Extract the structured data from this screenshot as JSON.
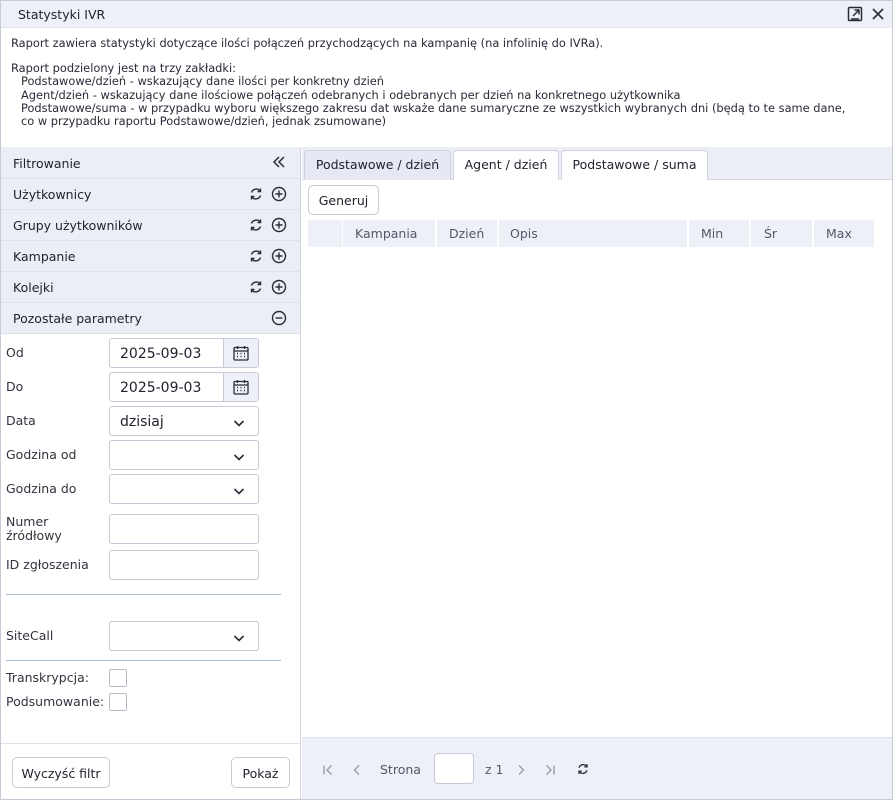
{
  "window": {
    "title": "Statystyki IVR"
  },
  "description": {
    "intro": "Raport zawiera statystyki dotyczące ilości połączeń przychodzących na kampanię (na infolinię do IVRa).",
    "tabs_intro": "Raport podzielony jest na trzy zakładki:",
    "line1": "Podstawowe/dzień - wskazujący dane ilości per konkretny dzień",
    "line2": "Agent/dzień - wskazujący dane ilościowe połączeń odebranych i odebranych per dzień na konkretnego użytkownika",
    "line3": "Podstawowe/suma - w przypadku wyboru większego zakresu dat wskaże dane sumaryczne ze wszystkich wybranych dni (będą to te same dane,",
    "line4": "co w przypadku raportu Podstawowe/dzień, jednak zsumowane)"
  },
  "filters": {
    "header": "Filtrowanie",
    "sections": {
      "users": "Użytkownicy",
      "user_groups": "Grupy użytkowników",
      "campaigns": "Kampanie",
      "queues": "Kolejki",
      "other_params": "Pozostałe parametry"
    },
    "fields": {
      "od_label": "Od",
      "od_value": "2025-09-03",
      "do_label": "Do",
      "do_value": "2025-09-03",
      "data_label": "Data",
      "data_value": "dzisiaj",
      "godzina_od_label": "Godzina od",
      "godzina_od_value": "",
      "godzina_do_label": "Godzina do",
      "godzina_do_value": "",
      "numer_label_1": "Numer",
      "numer_label_2": "źródłowy",
      "numer_value": "",
      "id_label": "ID zgłoszenia",
      "id_value": "",
      "sitecall_label": "SiteCall",
      "sitecall_value": "",
      "transkrypcja_label": "Transkrypcja:",
      "transkrypcja_checked": false,
      "podsumowanie_label": "Podsumowanie:",
      "podsumowanie_checked": false
    },
    "buttons": {
      "clear": "Wyczyść filtr",
      "show": "Pokaż"
    }
  },
  "report": {
    "tabs": [
      "Podstawowe / dzień",
      "Agent / dzień",
      "Podstawowe / suma"
    ],
    "active_tab": 0,
    "generate_label": "Generuj",
    "columns": [
      "Kampania",
      "Dzień",
      "Opis",
      "Min",
      "Śr",
      "Max"
    ],
    "rows": []
  },
  "pager": {
    "page_label": "Strona",
    "page_value": "",
    "of_label": "z 1"
  },
  "colors": {
    "panel_header": "#eceef6",
    "border": "#c8c9d6",
    "text": "#22222e",
    "separator": "#a9bfd0"
  }
}
